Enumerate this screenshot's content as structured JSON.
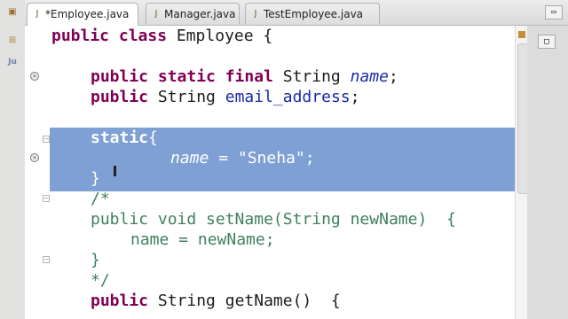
{
  "tabs": [
    {
      "label": "*Employee.java",
      "close": "⊠",
      "active": true
    },
    {
      "label": "Manager.java",
      "active": false
    },
    {
      "label": "TestEmployee.java",
      "active": false
    }
  ],
  "left_strip": {
    "icon3": "Ju"
  },
  "code": {
    "l1": {
      "kw": "public class",
      "rest": " Employee {"
    },
    "l2": {
      "kw": "public static final",
      "type": " String ",
      "field": "name",
      "end": ";"
    },
    "l3": {
      "kw": "public",
      "type": " String ",
      "field": "email_address",
      "end": ";"
    },
    "l4": {
      "kw": "static",
      "rest": "{"
    },
    "l5": {
      "field": "name",
      "rest": " = \"Sneha\";"
    },
    "l6": {
      "rest": "}"
    },
    "l7": {
      "rest": "/*"
    },
    "l8": {
      "rest": "public void setName(String newName)  {"
    },
    "l9": {
      "rest": "name = newName;"
    },
    "l10": {
      "rest": "}"
    },
    "l11": {
      "rest": "*/"
    },
    "l12": {
      "kw": "public",
      "rest": " String getName()  {"
    }
  },
  "colors": {
    "selection": "#7ea0d4",
    "keyword": "#7f0055",
    "field": "#1a2aa8"
  }
}
